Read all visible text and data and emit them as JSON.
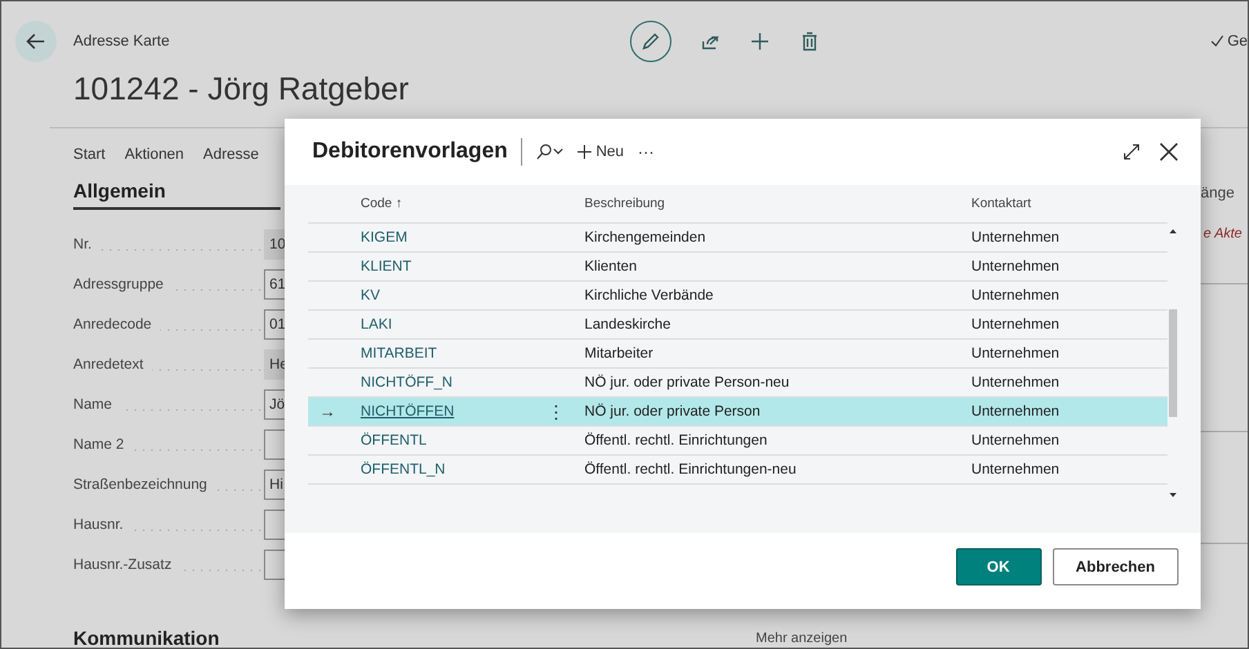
{
  "page": {
    "breadcrumb": "Adresse Karte",
    "title": "101242 - Jörg Ratgeber",
    "status": "Ge",
    "nav_tabs": [
      "Start",
      "Aktionen",
      "Adresse"
    ],
    "section": "Allgemein",
    "fields": [
      {
        "label": "Nr.",
        "value": "10",
        "editable": false
      },
      {
        "label": "Adressgruppe",
        "value": "61",
        "editable": true
      },
      {
        "label": "Anredecode",
        "value": "01",
        "editable": true
      },
      {
        "label": "Anredetext",
        "value": "He",
        "editable": false
      },
      {
        "label": "Name",
        "value": "Jö",
        "editable": true
      },
      {
        "label": "Name 2",
        "editable": true
      },
      {
        "label": "Straßenbezeichnung",
        "value": "Hi",
        "editable": true
      },
      {
        "label": "Hausnr.",
        "editable": true
      },
      {
        "label": "Hausnr.-Zusatz",
        "editable": true
      }
    ],
    "section_2": "Kommunikation",
    "side_heading": "änge",
    "side_note": "e Akte",
    "more_link": "Mehr anzeigen"
  },
  "dialog": {
    "title": "Debitorenvorlagen",
    "new_label": "Neu",
    "more": "···",
    "columns": [
      {
        "label": "Code",
        "sort": "↑"
      },
      {
        "label": "Beschreibung"
      },
      {
        "label": "Kontaktart"
      }
    ],
    "row_marker": "→",
    "row_menu": "⋮",
    "rows": [
      {
        "code": "KIGEM",
        "description": "Kirchengemeinden",
        "contact_type": "Unternehmen",
        "selected": false
      },
      {
        "code": "KLIENT",
        "description": "Klienten",
        "contact_type": "Unternehmen",
        "selected": false
      },
      {
        "code": "KV",
        "description": "Kirchliche Verbände",
        "contact_type": "Unternehmen",
        "selected": false
      },
      {
        "code": "LAKI",
        "description": "Landeskirche",
        "contact_type": "Unternehmen",
        "selected": false
      },
      {
        "code": "MITARBEIT",
        "description": "Mitarbeiter",
        "contact_type": "Unternehmen",
        "selected": false
      },
      {
        "code": "NICHTÖFF_N",
        "description": "NÖ jur. oder private Person-neu",
        "contact_type": "Unternehmen",
        "selected": false
      },
      {
        "code": "NICHTÖFFEN",
        "description": "NÖ jur. oder private Person",
        "contact_type": "Unternehmen",
        "selected": true
      },
      {
        "code": "ÖFFENTL",
        "description": "Öffentl. rechtl. Einrichtungen",
        "contact_type": "Unternehmen",
        "selected": false
      },
      {
        "code": "ÖFFENTL_N",
        "description": "Öffentl. rechtl. Einrichtungen-neu",
        "contact_type": "Unternehmen",
        "selected": false
      }
    ],
    "buttons": [
      {
        "label": "OK",
        "kind": "primary"
      },
      {
        "label": "Abbrechen",
        "kind": "secondary"
      }
    ]
  }
}
